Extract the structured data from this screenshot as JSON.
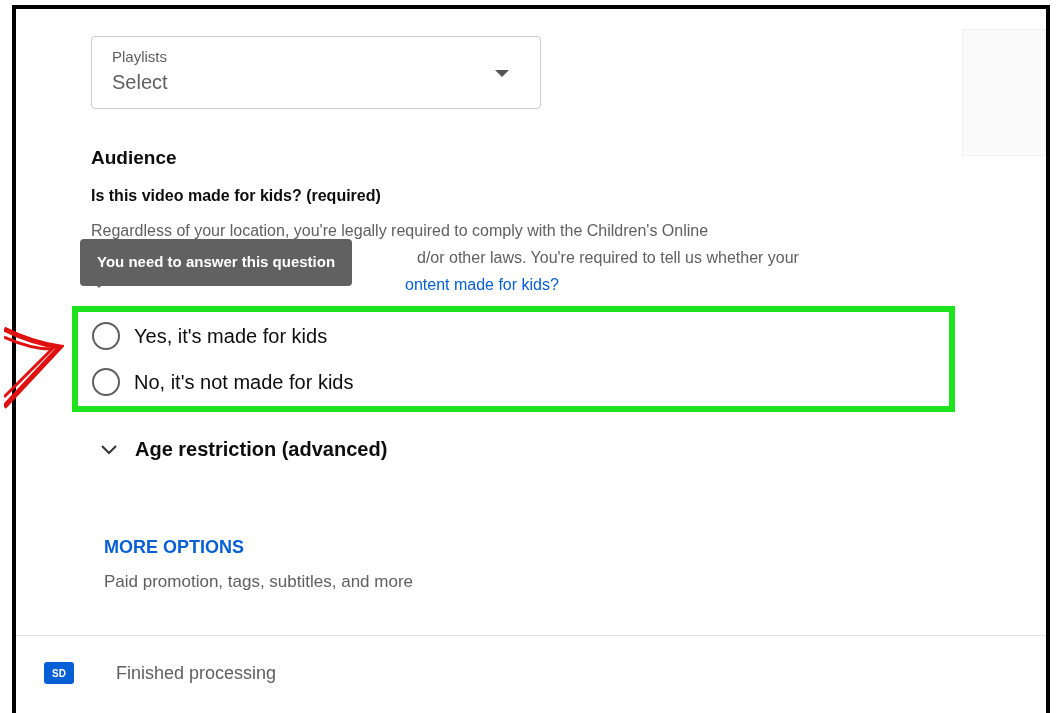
{
  "playlists_dropdown": {
    "label": "Playlists",
    "value": "Select"
  },
  "audience": {
    "heading": "Audience",
    "question": "Is this video made for kids? (required)",
    "description_line_1": "Regardless of your location, you're legally required to comply with the Children's Online",
    "description_line_2_visible": "d/or other laws. You're required to tell us whether your",
    "link_visible": "ontent made for kids?",
    "tooltip": "You need to answer this question",
    "options": [
      {
        "label": "Yes, it's made for kids",
        "selected": false
      },
      {
        "label": "No, it's not made for kids",
        "selected": false
      }
    ]
  },
  "age_restriction": {
    "label": "Age restriction (advanced)",
    "expanded": false
  },
  "more_options": {
    "label": "MORE OPTIONS",
    "description": "Paid promotion, tags, subtitles, and more"
  },
  "footer": {
    "badge": "SD",
    "status": "Finished processing"
  }
}
